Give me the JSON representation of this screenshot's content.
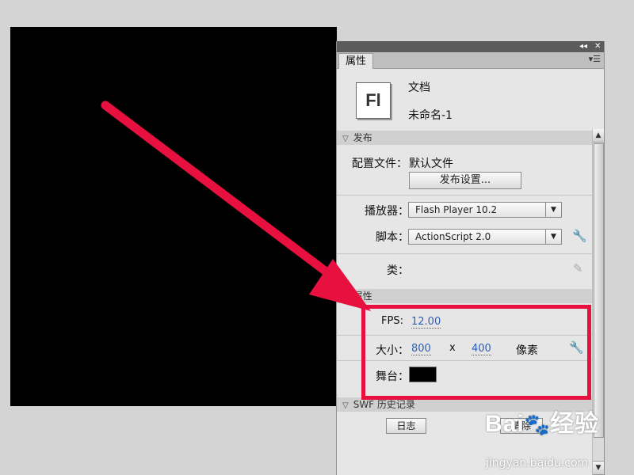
{
  "panel": {
    "tab_label": "属性",
    "collapse_glyph": "◂◂",
    "close_glyph": "✕",
    "menu_glyph": "▾☰"
  },
  "document": {
    "icon_text": "Fl",
    "type_label": "文档",
    "name": "未命名-1"
  },
  "publish": {
    "section_label": "发布",
    "profile_label": "配置文件：",
    "profile_value": "默认文件",
    "settings_button": "发布设置...",
    "player_label": "播放器：",
    "player_value": "Flash Player 10.2",
    "script_label": "脚本：",
    "script_value": "ActionScript 2.0",
    "class_label": "类："
  },
  "properties": {
    "section_label": "属性",
    "fps_label": "FPS:",
    "fps_value": "12.00",
    "size_label": "大小：",
    "width": "800",
    "x_sep": "x",
    "height": "400",
    "unit": "像素",
    "stage_label": "舞台：",
    "stage_color": "#000000"
  },
  "swf_history": {
    "section_label": "SWF 历史记录",
    "log_button": "日志",
    "clear_button": "清除"
  },
  "watermark": {
    "logo": "Bai",
    "logo_suffix": "经验",
    "url": "jingyan.baidu.com"
  },
  "colors": {
    "annotation": "#e8103f",
    "link": "#2b5eb5"
  },
  "icons": {
    "dropdown": "▼",
    "wrench": "🔧",
    "pencil": "✎",
    "section_toggle": "▽",
    "scroll_up": "▲",
    "scroll_down": "▼",
    "paw": "🐾"
  }
}
